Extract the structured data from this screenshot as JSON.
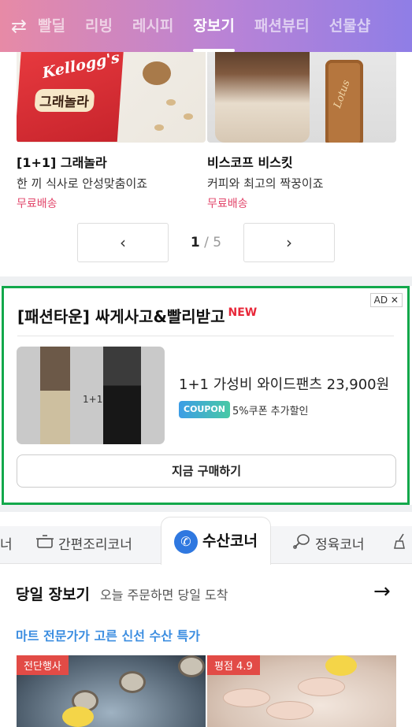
{
  "top_nav": {
    "tabs": [
      {
        "label": "빨딜"
      },
      {
        "label": "리빙"
      },
      {
        "label": "레시피"
      },
      {
        "label": "장보기",
        "active": true
      },
      {
        "label": "패션뷰티"
      },
      {
        "label": "선물샵"
      }
    ]
  },
  "products": [
    {
      "name": "[1+1] 그래놀라",
      "desc": "한 끼 식사로 안성맞춤이죠",
      "shipping": "무료배송",
      "image_brand": "Kellogg's",
      "image_text": "그래놀라"
    },
    {
      "name": "비스코프 비스킷",
      "desc": "커피와 최고의 짝꿍이죠",
      "shipping": "무료배송",
      "image_brand": "Lotus"
    }
  ],
  "pager": {
    "current": "1",
    "separator": "/",
    "total": "5",
    "prev_icon": "‹",
    "next_icon": "›"
  },
  "ad": {
    "tag": "AD ✕",
    "title": "[패션타운] 싸게사고&빨리받고",
    "badge": "NEW",
    "image_label": "1+1",
    "product": "1+1 가성비 와이드팬츠 23,900원",
    "coupon_label": "COUPON",
    "coupon_text": "5%쿠폰 추가할인",
    "buy_label": "지금 구매하기",
    "border_color": "#12a84b"
  },
  "corners": {
    "tabs": [
      {
        "label": "너",
        "icon": "partial"
      },
      {
        "label": "간편조리코너",
        "icon": "pot-icon"
      },
      {
        "label": "수산코너",
        "icon": "fish-icon",
        "active": true
      },
      {
        "label": "정육코너",
        "icon": "meat-icon"
      },
      {
        "label": "",
        "icon": "broom-icon"
      }
    ]
  },
  "same_day": {
    "title": "당일 장보기",
    "subtitle": "오늘 주문하면 당일 도착",
    "arrow": "→",
    "pick_title": "마트 전문가가 고른 신선 수산 특가",
    "items": [
      {
        "label": "전단행사"
      },
      {
        "label": "평점 4.9"
      }
    ]
  }
}
